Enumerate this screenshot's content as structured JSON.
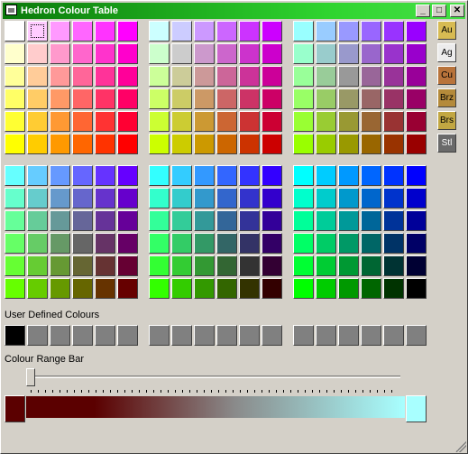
{
  "window": {
    "title": "Hedron Colour Table",
    "minimize": "_",
    "maximize": "□",
    "close": "✕"
  },
  "metals": [
    {
      "label": "Au",
      "color": "#d7bb53"
    },
    {
      "label": "Ag",
      "color": "#ececec"
    },
    {
      "label": "Cu",
      "color": "#b8733a"
    },
    {
      "label": "Brz",
      "color": "#b48a3a"
    },
    {
      "label": "Brs",
      "color": "#c2a742"
    },
    {
      "label": "Stl",
      "color": "#6a6a6a"
    }
  ],
  "labels": {
    "user_defined": "User Defined Colours",
    "range_bar": "Colour Range Bar"
  },
  "user_defined_colors": [
    "#000000",
    "#808080",
    "#808080",
    "#808080",
    "#808080",
    "#808080",
    "#808080",
    "#808080",
    "#808080",
    "#808080",
    "#808080",
    "#808080",
    "#808080",
    "#808080",
    "#808080",
    "#808080",
    "#808080",
    "#808080"
  ],
  "range": {
    "start_color": "#5b0000",
    "end_color": "#a8ffff",
    "slider_value": 0
  },
  "selected_cell": {
    "panel": 0,
    "row": 0,
    "col": 1
  }
}
